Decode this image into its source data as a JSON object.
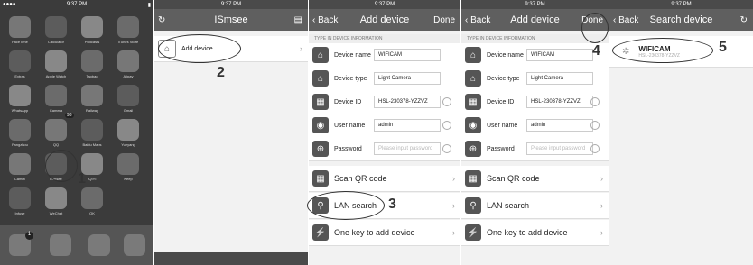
{
  "home": {
    "time": "9:37 PM",
    "dock": [
      "Phone",
      "Mail",
      "Safari",
      "Music"
    ],
    "badge": "1",
    "qq_badge": "98",
    "apps": [
      "FaceTime",
      "Calculator",
      "Podcasts",
      "iTunes Store",
      "Extras",
      "Apple Watch",
      "Taobao",
      "Alipay",
      "WhatsApp",
      "Camera",
      "Railway",
      "Gmail",
      "Fangzhou",
      "QQ",
      "Baidu Maps",
      "Yueyang",
      "CamHi",
      "ISmsee",
      "iQIYI",
      "Keep",
      "Infuse",
      "WeChat",
      "OK"
    ]
  },
  "s2": {
    "time": "9:37 PM",
    "title": "ISmsee",
    "item": "Add device"
  },
  "s3": {
    "time": "9:37 PM",
    "back": "Back",
    "title": "Add device",
    "done": "Done",
    "section": "TYPE IN DEVICE INFORMATION",
    "rows": [
      {
        "label": "Device name",
        "value": "WIFICAM"
      },
      {
        "label": "Device type",
        "value": "Light Camera"
      },
      {
        "label": "Device ID",
        "value": "HSL-230378-YZZVZ"
      },
      {
        "label": "User name",
        "value": "admin"
      },
      {
        "label": "Password",
        "placeholder": "Please input password"
      }
    ],
    "scan": "Scan QR code",
    "lan": "LAN search",
    "onekey": "One key to add device"
  },
  "s5": {
    "time": "9:37 PM",
    "back": "Back",
    "title": "Search device",
    "dev_name": "WIFICAM",
    "dev_id": "HSL-230378-YZZVZ"
  },
  "annotations": [
    "1",
    "2",
    "3",
    "4",
    "5"
  ]
}
